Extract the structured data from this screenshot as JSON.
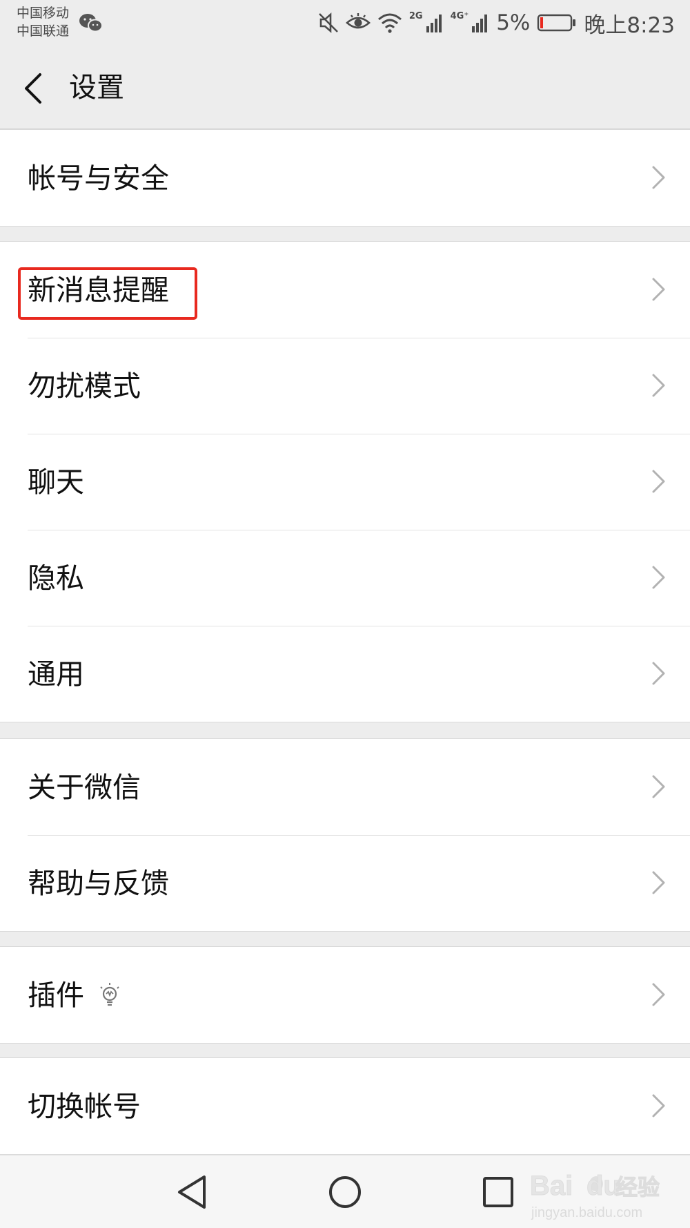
{
  "status_bar": {
    "carrier_1": "中国移动",
    "carrier_2": "中国联通",
    "net_2g": "2G",
    "net_4g": "4G⁺",
    "battery_pct": "5%",
    "time": "晚上8:23",
    "battery_level": 0.05,
    "icons": [
      "wechat-icon",
      "mute-icon",
      "eye-comfort-icon",
      "wifi-icon",
      "signal-icon",
      "battery-icon"
    ]
  },
  "header": {
    "title": "设置",
    "back_icon": "chevron-left-icon"
  },
  "settings": {
    "account": {
      "label": "帐号与安全"
    },
    "notifications": {
      "label": "新消息提醒",
      "highlighted": true,
      "highlight_color": "#e8291f"
    },
    "dnd": {
      "label": "勿扰模式"
    },
    "chat": {
      "label": "聊天"
    },
    "privacy": {
      "label": "隐私"
    },
    "general": {
      "label": "通用"
    },
    "about": {
      "label": "关于微信"
    },
    "help": {
      "label": "帮助与反馈"
    },
    "plugins": {
      "label": "插件",
      "icon": "lightbulb-icon"
    },
    "switch_account": {
      "label": "切换帐号"
    }
  },
  "nav_bar": {
    "icons": [
      "back-triangle-icon",
      "home-circle-icon",
      "recents-square-icon"
    ]
  },
  "watermark": {
    "brand": "Bai",
    "brand_tail": "du",
    "brand_cn": "经验",
    "url": "jingyan.baidu.com"
  },
  "colors": {
    "background": "#ededed",
    "cell": "#ffffff",
    "highlight": "#e8291f",
    "text": "#111111"
  }
}
